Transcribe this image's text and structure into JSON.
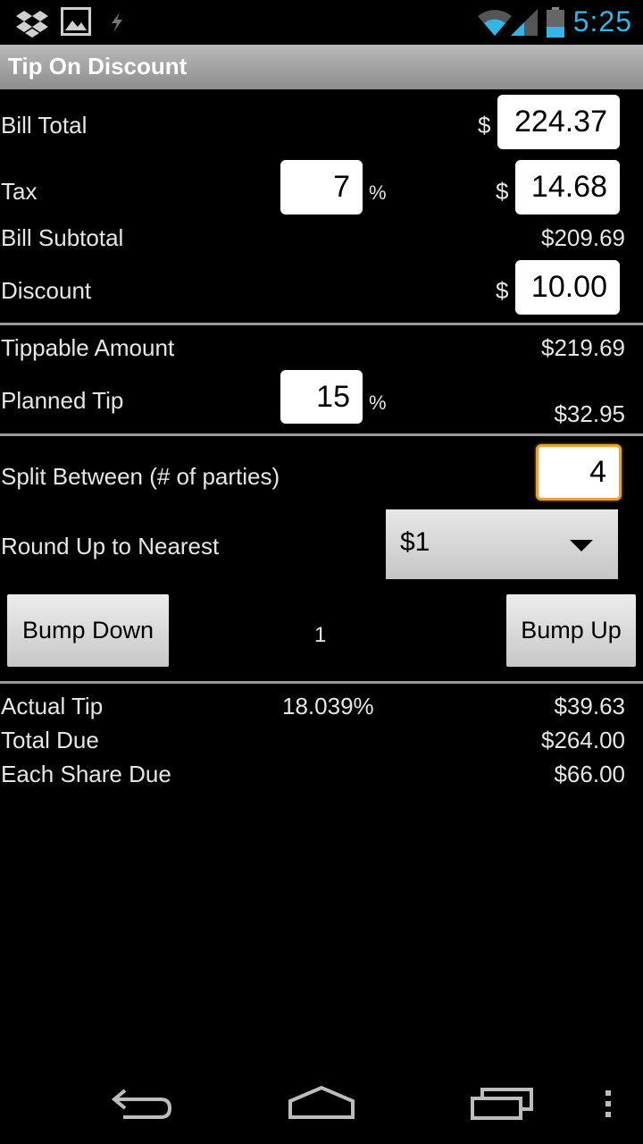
{
  "status_bar": {
    "time": "5:25",
    "icons": [
      "dropbox-icon",
      "gallery-icon",
      "charging-icon",
      "wifi-icon",
      "signal-icon",
      "battery-icon"
    ]
  },
  "app": {
    "title": "Tip On Discount"
  },
  "form": {
    "bill_total": {
      "label": "Bill Total",
      "currency": "$",
      "value": "224.37"
    },
    "tax": {
      "label": "Tax",
      "percent": "7",
      "percent_unit": "%",
      "currency": "$",
      "amount": "14.68"
    },
    "bill_subtotal": {
      "label": "Bill Subtotal",
      "value": "$209.69"
    },
    "discount": {
      "label": "Discount",
      "currency": "$",
      "value": "10.00"
    },
    "tippable_amount": {
      "label": "Tippable Amount",
      "value": "$219.69"
    },
    "planned_tip": {
      "label": "Planned Tip",
      "percent": "15",
      "percent_unit": "%",
      "value": "$32.95"
    },
    "split": {
      "label": "Split Between (# of parties)",
      "value": "4"
    },
    "round_up": {
      "label": "Round Up to Nearest",
      "selected": "$1"
    },
    "bump": {
      "down_label": "Bump Down",
      "up_label": "Bump Up",
      "count": "1"
    }
  },
  "results": {
    "actual_tip": {
      "label": "Actual Tip",
      "percent": "18.039%",
      "value": "$39.63"
    },
    "total_due": {
      "label": "Total Due",
      "value": "$264.00"
    },
    "each_share": {
      "label": "Each Share Due",
      "value": "$66.00"
    }
  },
  "nav_bar": {
    "icons": [
      "back-icon",
      "home-icon",
      "recent-apps-icon",
      "menu-icon"
    ]
  },
  "colors": {
    "accent": "#33b5e5",
    "focus": "#e8a13a"
  }
}
